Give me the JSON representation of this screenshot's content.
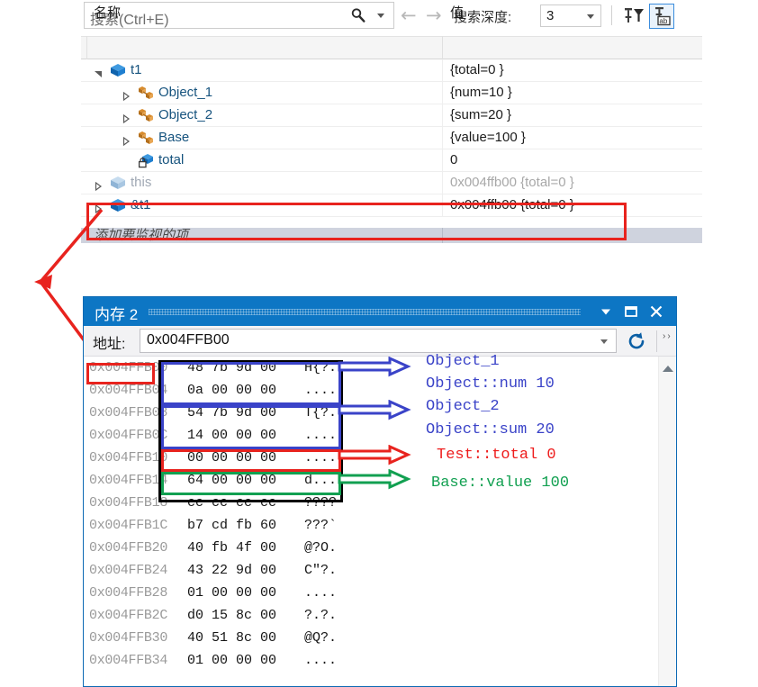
{
  "watch_panel": {
    "search": {
      "placeholder": "搜索(Ctrl+E)",
      "value": "",
      "icon": "search-icon",
      "dropdown_icon": "chevron-down-icon"
    },
    "nav": {
      "back_icon": "arrow-left-icon",
      "forward_icon": "arrow-right-icon"
    },
    "search_depth": {
      "label": "搜索深度:",
      "value": "3",
      "dropdown_icon": "chevron-down-icon"
    },
    "toolbar_buttons": [
      {
        "name": "pin-filter-icon",
        "selected": false
      },
      {
        "name": "pin-ab-icon",
        "selected": true
      }
    ],
    "columns": {
      "name": "名称",
      "value": "值"
    },
    "rows": [
      {
        "name": "t1",
        "value": "{total=0 }",
        "indent": 0,
        "expander": "expanded",
        "icon": "variable-box-icon",
        "dim": false
      },
      {
        "name": "Object_1",
        "value": "{num=10 }",
        "indent": 1,
        "expander": "collapsed",
        "icon": "class-node-icon",
        "dim": false
      },
      {
        "name": "Object_2",
        "value": "{sum=20 }",
        "indent": 1,
        "expander": "collapsed",
        "icon": "class-node-icon",
        "dim": false
      },
      {
        "name": "Base",
        "value": "{value=100 }",
        "indent": 1,
        "expander": "collapsed",
        "icon": "class-node-icon",
        "dim": false
      },
      {
        "name": "total",
        "value": "0",
        "indent": 1,
        "expander": "none",
        "icon": "private-field-icon",
        "dim": false
      },
      {
        "name": "this",
        "value": "0x004ffb00 {total=0 }",
        "indent": 0,
        "expander": "collapsed",
        "icon": "variable-box-icon",
        "dim": true
      },
      {
        "name": "&t1",
        "value": "0x004ffb00 {total=0 }",
        "indent": 0,
        "expander": "collapsed",
        "icon": "variable-box-icon",
        "dim": false
      }
    ],
    "add_watch_row": "添加要监视的项"
  },
  "memory_window": {
    "title": "内存 2",
    "title_buttons": {
      "dropdown": "chevron-down-icon",
      "maximize": "restore-window-icon",
      "close": "close-icon"
    },
    "address_label": "地址:",
    "address_value": "0x004FFB00",
    "address_dropdown_icon": "chevron-down-icon",
    "refresh_icon": "refresh-icon",
    "overflow_icon": "toolbar-overflow-icon",
    "scrollbar": {
      "up_arrow_icon": "scroll-up-icon"
    },
    "lines": [
      {
        "address": "0x004FFB00",
        "hex": "48 7b 9d 00",
        "ascii": "H{?."
      },
      {
        "address": "0x004FFB04",
        "hex": "0a 00 00 00",
        "ascii": "...."
      },
      {
        "address": "0x004FFB08",
        "hex": "54 7b 9d 00",
        "ascii": "T{?."
      },
      {
        "address": "0x004FFB0C",
        "hex": "14 00 00 00",
        "ascii": "...."
      },
      {
        "address": "0x004FFB10",
        "hex": "00 00 00 00",
        "ascii": "...."
      },
      {
        "address": "0x004FFB14",
        "hex": "64 00 00 00",
        "ascii": "d..."
      },
      {
        "address": "0x004FFB18",
        "hex": "cc cc cc cc",
        "ascii": "????"
      },
      {
        "address": "0x004FFB1C",
        "hex": "b7 cd fb 60",
        "ascii": "???`"
      },
      {
        "address": "0x004FFB20",
        "hex": "40 fb 4f 00",
        "ascii": "@?O."
      },
      {
        "address": "0x004FFB24",
        "hex": "43 22 9d 00",
        "ascii": "C\"?."
      },
      {
        "address": "0x004FFB28",
        "hex": "01 00 00 00",
        "ascii": "...."
      },
      {
        "address": "0x004FFB2C",
        "hex": "d0 15 8c 00",
        "ascii": "?.?."
      },
      {
        "address": "0x004FFB30",
        "hex": "40 51 8c 00",
        "ascii": "@Q?."
      },
      {
        "address": "0x004FFB34",
        "hex": "01 00 00 00",
        "ascii": "...."
      }
    ]
  },
  "annotations": {
    "labels": [
      {
        "text": "Object_1",
        "color": "#3a43c8"
      },
      {
        "text": "Object::num 10",
        "color": "#3a43c8"
      },
      {
        "text": "Object_2",
        "color": "#3a43c8"
      },
      {
        "text": "Object::sum 20",
        "color": "#3a43c8"
      },
      {
        "text": "Test::total 0",
        "color": "#ee1c1c"
      },
      {
        "text": "Base::value 100",
        "color": "#12a051"
      }
    ],
    "colors": {
      "blue": "#3a43c8",
      "red": "#e8231e",
      "green": "#12a051",
      "black": "#000000"
    }
  }
}
